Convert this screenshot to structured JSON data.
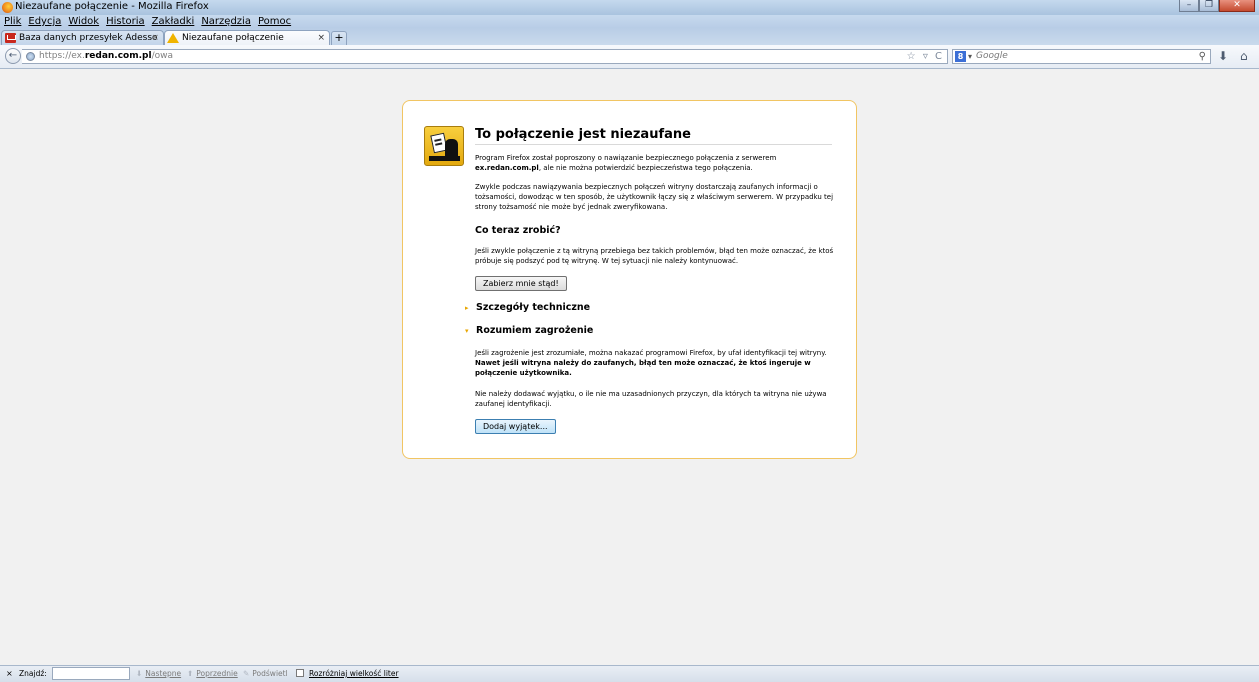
{
  "window": {
    "title": "Niezaufane połączenie - Mozilla Firefox",
    "minimize_glyph": "–",
    "maximize_glyph": "❐",
    "close_glyph": "✕"
  },
  "menubar": {
    "items": [
      "Plik",
      "Edycja",
      "Widok",
      "Historia",
      "Zakładki",
      "Narzędzia",
      "Pomoc"
    ]
  },
  "tabs": [
    {
      "label": "Baza danych przesyłek Adesso",
      "icon": "mail-icon",
      "close": "×"
    },
    {
      "label": "Niezaufane połączenie",
      "icon": "warning-icon",
      "close": "×"
    }
  ],
  "newtab_glyph": "+",
  "navbar": {
    "back_glyph": "←",
    "url_proto": "https://ex.",
    "url_domain": "redan.com.pl",
    "url_path": "/owa",
    "url_icons": "☆ ▿ C",
    "search_engine_glyph": "8",
    "search_drop": "▾",
    "search_placeholder": "Google",
    "search_glyph": "⚲",
    "download_glyph": "⬇",
    "home_glyph": "⌂"
  },
  "error": {
    "title": "To połączenie jest niezaufane",
    "p1_pre": "Program Firefox został poproszony o nawiązanie bezpiecznego połączenia z serwerem ",
    "p1_host": "ex.redan.com.pl",
    "p1_post": ", ale nie można potwierdzić bezpieczeństwa tego połączenia.",
    "p2": "Zwykle podczas nawiązywania bezpiecznych połączeń witryny dostarczają zaufanych informacji o tożsamości, dowodząc w ten sposób, że użytkownik łączy się z właściwym serwerem. W przypadku tej strony tożsamość nie może być jednak zweryfikowana.",
    "what_heading": "Co teraz zrobić?",
    "p3": "Jeśli zwykle połączenie z tą witryną przebiega bez takich problemów, błąd ten może oznaczać, że ktoś próbuje się podszyć pod tę witrynę. W tej sytuacji nie należy kontynuować.",
    "getme_out_label": "Zabierz mnie stąd!",
    "tech_heading": "Szczegóły techniczne",
    "tech_tri": "▸",
    "risk_heading": "Rozumiem zagrożenie",
    "risk_tri": "▾",
    "p4_pre": "Jeśli zagrożenie jest zrozumiałe, można nakazać programowi Firefox, by ufał identyfikacji tej witryny. ",
    "p4_bold": "Nawet jeśli witryna należy do zaufanych, błąd ten może oznaczać, że ktoś ingeruje w połączenie użytkownika.",
    "p5": "Nie należy dodawać wyjątku, o ile nie ma uzasadnionych przyczyn, dla których ta witryna nie używa zaufanej identyfikacji.",
    "add_exception_label": "Dodaj wyjątek..."
  },
  "findbar": {
    "close_glyph": "×",
    "label": "Znajdź:",
    "next_label": "Następne",
    "prev_label": "Poprzednie",
    "highlight_label": "Podświetl",
    "matchcase_label": "Rozróżniaj wielkość liter"
  },
  "colors": {
    "accent_border": "#f1c563",
    "triangle": "#e8a600"
  }
}
